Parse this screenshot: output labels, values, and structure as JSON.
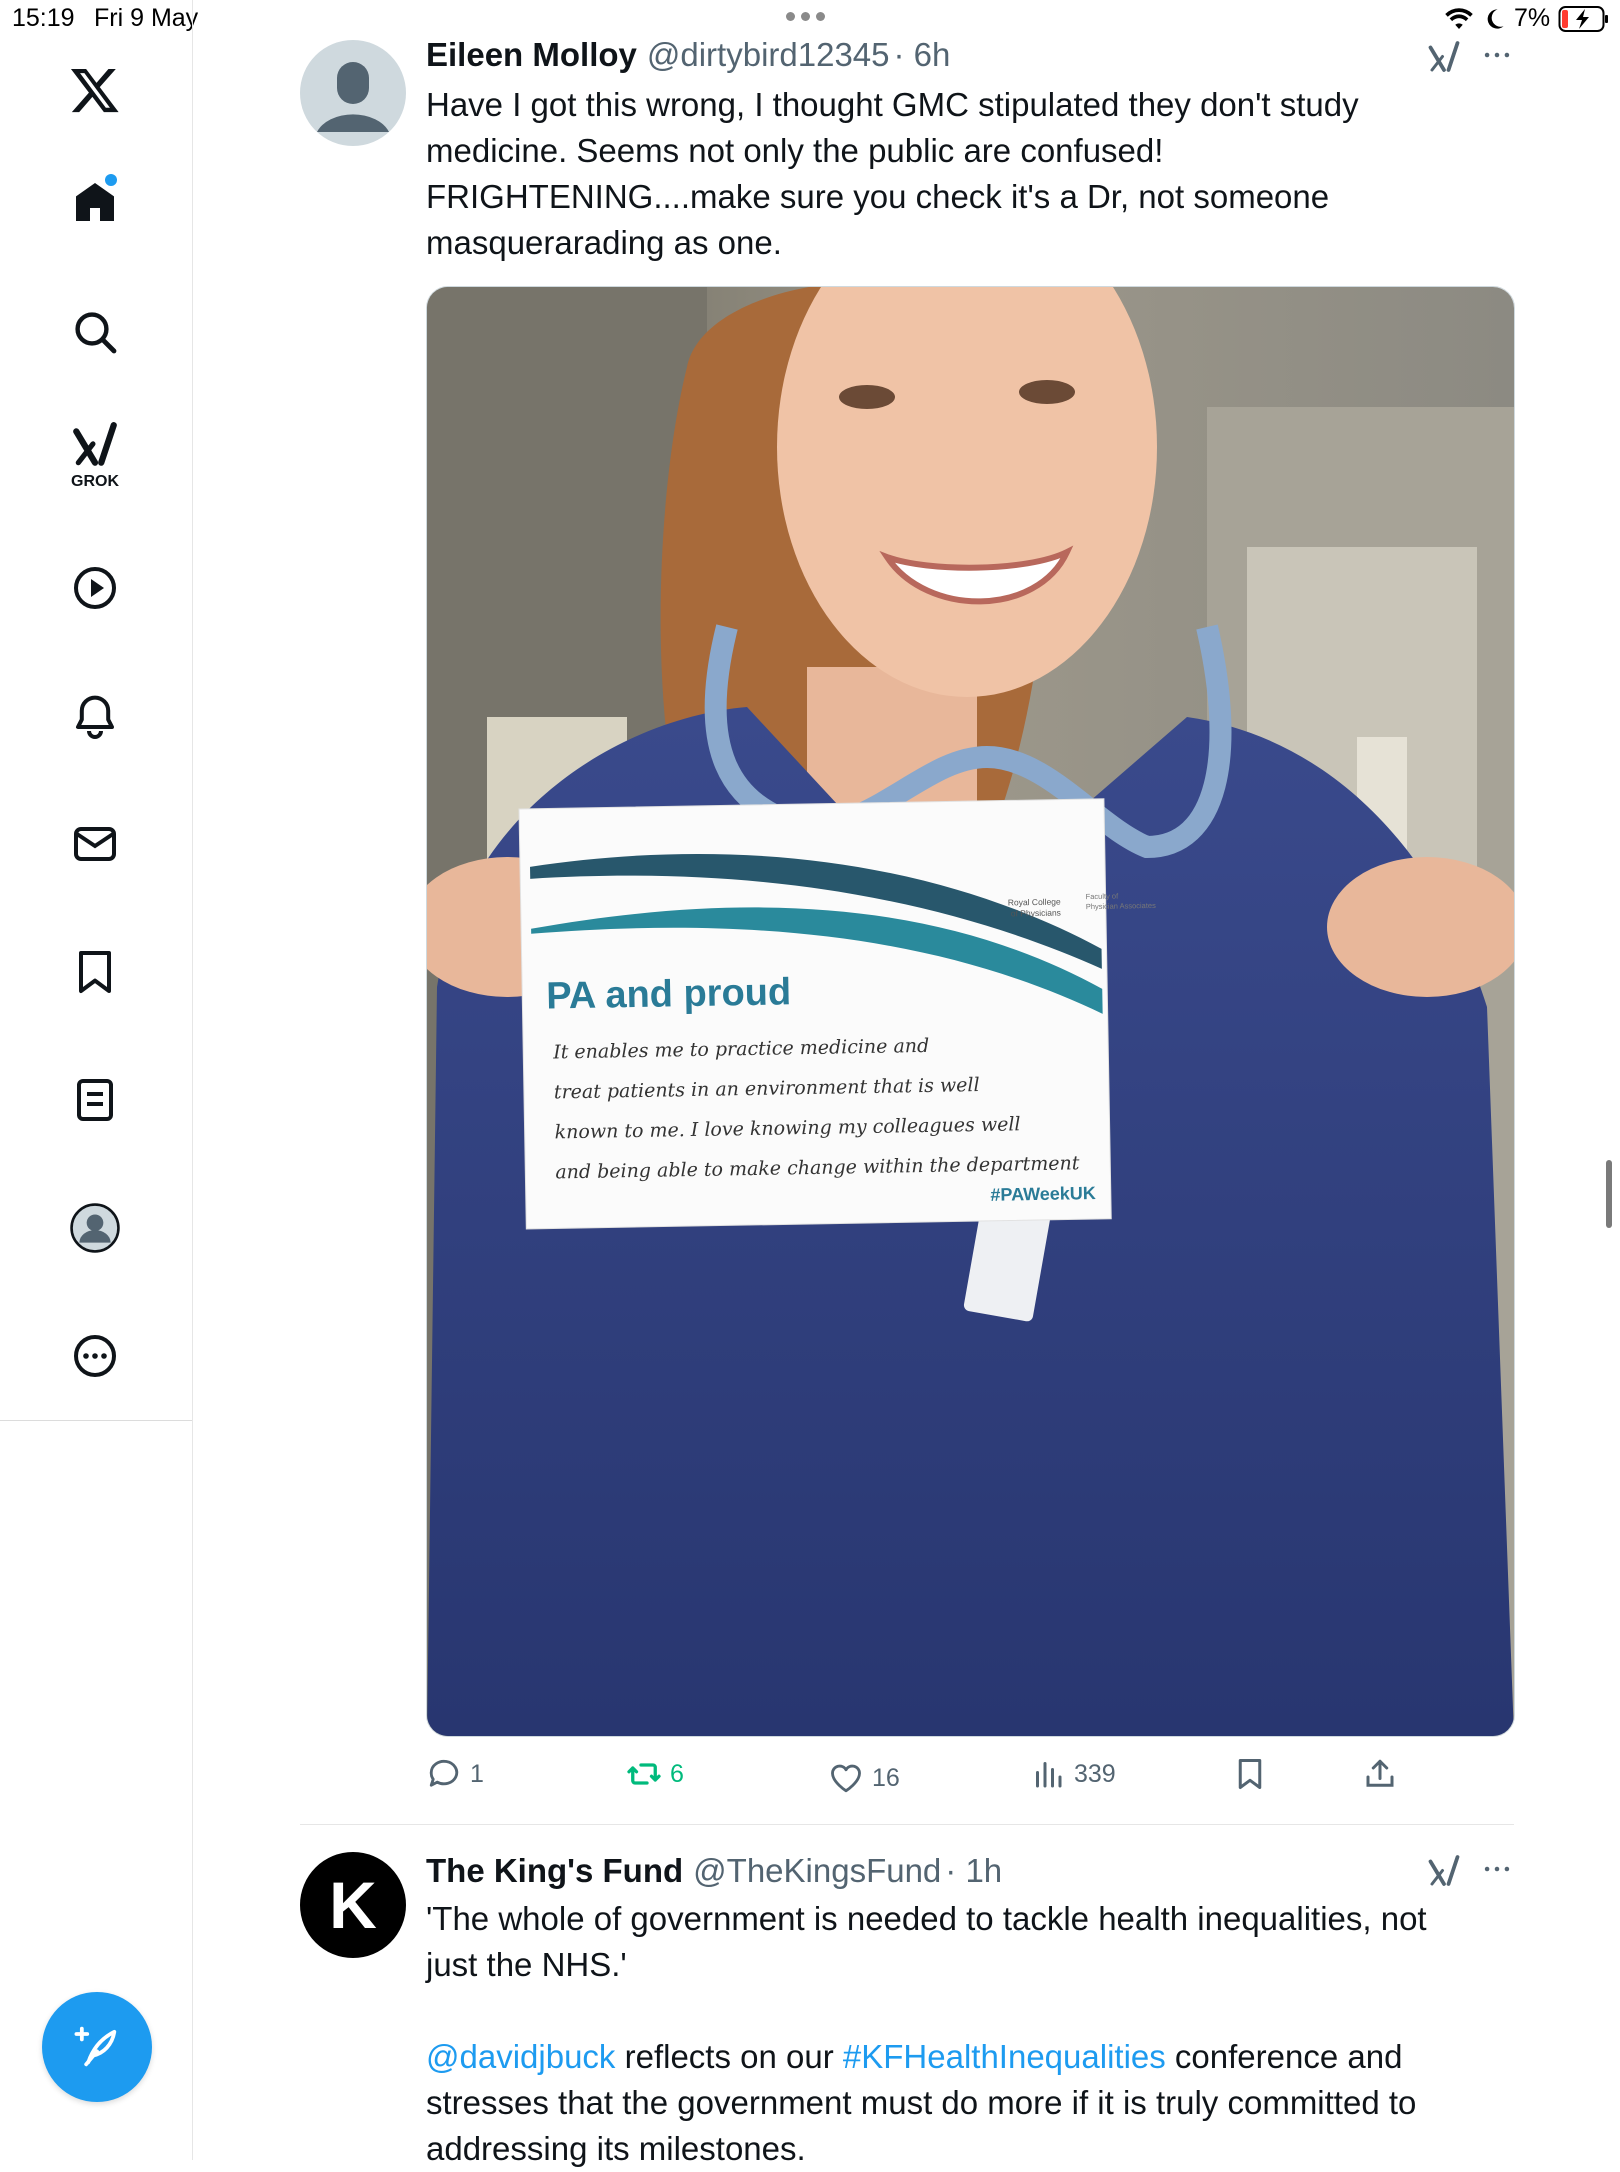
{
  "status_bar": {
    "time": "15:19",
    "date": "Fri 9 May",
    "battery": "7%",
    "icons": [
      "wifi-icon",
      "moon-icon",
      "battery-charging-icon"
    ]
  },
  "sidebar": {
    "items": [
      {
        "name": "x-logo",
        "icon": "x-logo-icon"
      },
      {
        "name": "home",
        "icon": "home-icon"
      },
      {
        "name": "search",
        "icon": "search-icon"
      },
      {
        "name": "grok",
        "icon": "grok-icon",
        "label": "GROK"
      },
      {
        "name": "video",
        "icon": "play-icon"
      },
      {
        "name": "notifications",
        "icon": "bell-icon"
      },
      {
        "name": "messages",
        "icon": "mail-icon"
      },
      {
        "name": "bookmarks",
        "icon": "bookmark-icon"
      },
      {
        "name": "lists",
        "icon": "list-icon"
      },
      {
        "name": "profile",
        "icon": "avatar-icon"
      },
      {
        "name": "more",
        "icon": "more-circle-icon"
      }
    ],
    "compose_icon": "compose-icon"
  },
  "tweets": [
    {
      "name": "Eileen Molloy",
      "handle": "@dirtybird12345",
      "time": "· 6h",
      "text_lines": [
        "Have I got this wrong, I thought GMC stipulated they don't study",
        "medicine. Seems not only the public are confused!",
        "FRIGHTENING....make sure you check it's a Dr, not someone",
        "masquerarading as one."
      ],
      "media": {
        "sign_title": "PA and proud",
        "org1": "Royal College",
        "org2": "of Physicians",
        "org3": "Faculty of",
        "org4": "Physician Associates",
        "handwriting": [
          "It enables me to practice medicine and",
          "treat patients in an environment that is well",
          "known to me. I love knowing my colleagues well",
          "and being able to make change within the department"
        ],
        "hashtag": "#PAWeekUK"
      },
      "stats": {
        "replies": "1",
        "retweets": "6",
        "likes": "16",
        "views": "339"
      }
    },
    {
      "name": "The King's Fund",
      "handle": "@TheKingsFund",
      "time": "· 1h",
      "avatar_letter": "K",
      "text_line1": "'The whole of government is needed to tackle health inequalities, not",
      "text_line2": "just the NHS.'",
      "mention": "@davidjbuck",
      "text_mid": " reflects on our ",
      "hashtag": "#KFHealthInequalities",
      "text_after": " conference and",
      "text_line4": "stresses that the government must do more if it is truly committed to",
      "text_line5": "addressing its milestones."
    }
  ],
  "colors": {
    "accent": "#1d9bf0",
    "retweet": "#00ba7c",
    "muted": "#536471"
  }
}
